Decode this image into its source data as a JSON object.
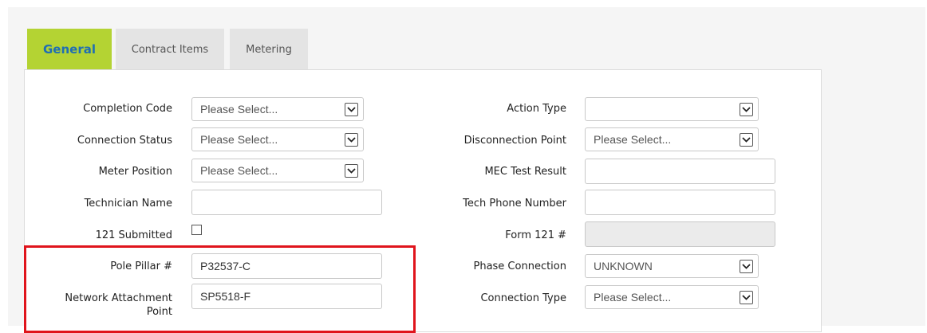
{
  "tabs": [
    {
      "label": "General",
      "active": true
    },
    {
      "label": "Contract Items",
      "active": false
    },
    {
      "label": "Metering",
      "active": false
    }
  ],
  "fields": {
    "completion_code": {
      "label": "Completion Code",
      "value": "Please Select..."
    },
    "connection_status": {
      "label": "Connection Status",
      "value": "Please Select..."
    },
    "meter_position": {
      "label": "Meter Position",
      "value": "Please Select..."
    },
    "technician_name": {
      "label": "Technician Name",
      "value": ""
    },
    "submitted_121": {
      "label": "121 Submitted",
      "checked": false
    },
    "pole_pillar": {
      "label": "Pole Pillar #",
      "value": "P32537-C"
    },
    "network_attachment_point": {
      "label_line1": "Network Attachment",
      "label_line2": "Point",
      "value": "SP5518-F"
    },
    "action_type": {
      "label": "Action Type",
      "value": ""
    },
    "disconnection_point": {
      "label": "Disconnection Point",
      "value": "Please Select..."
    },
    "mec_test_result": {
      "label": "MEC Test Result",
      "value": ""
    },
    "tech_phone_number": {
      "label": "Tech Phone Number",
      "value": ""
    },
    "form_121": {
      "label": "Form 121 #",
      "value": ""
    },
    "phase_connection": {
      "label": "Phase Connection",
      "value": "UNKNOWN"
    },
    "connection_type": {
      "label": "Connection Type",
      "value": "Please Select..."
    }
  },
  "icons": {
    "dropdown_arrow": "chevron-down-icon"
  },
  "colors": {
    "active_tab_bg": "#b4d333",
    "active_tab_text": "#1f6eb4",
    "highlight_border": "#e0141c"
  }
}
